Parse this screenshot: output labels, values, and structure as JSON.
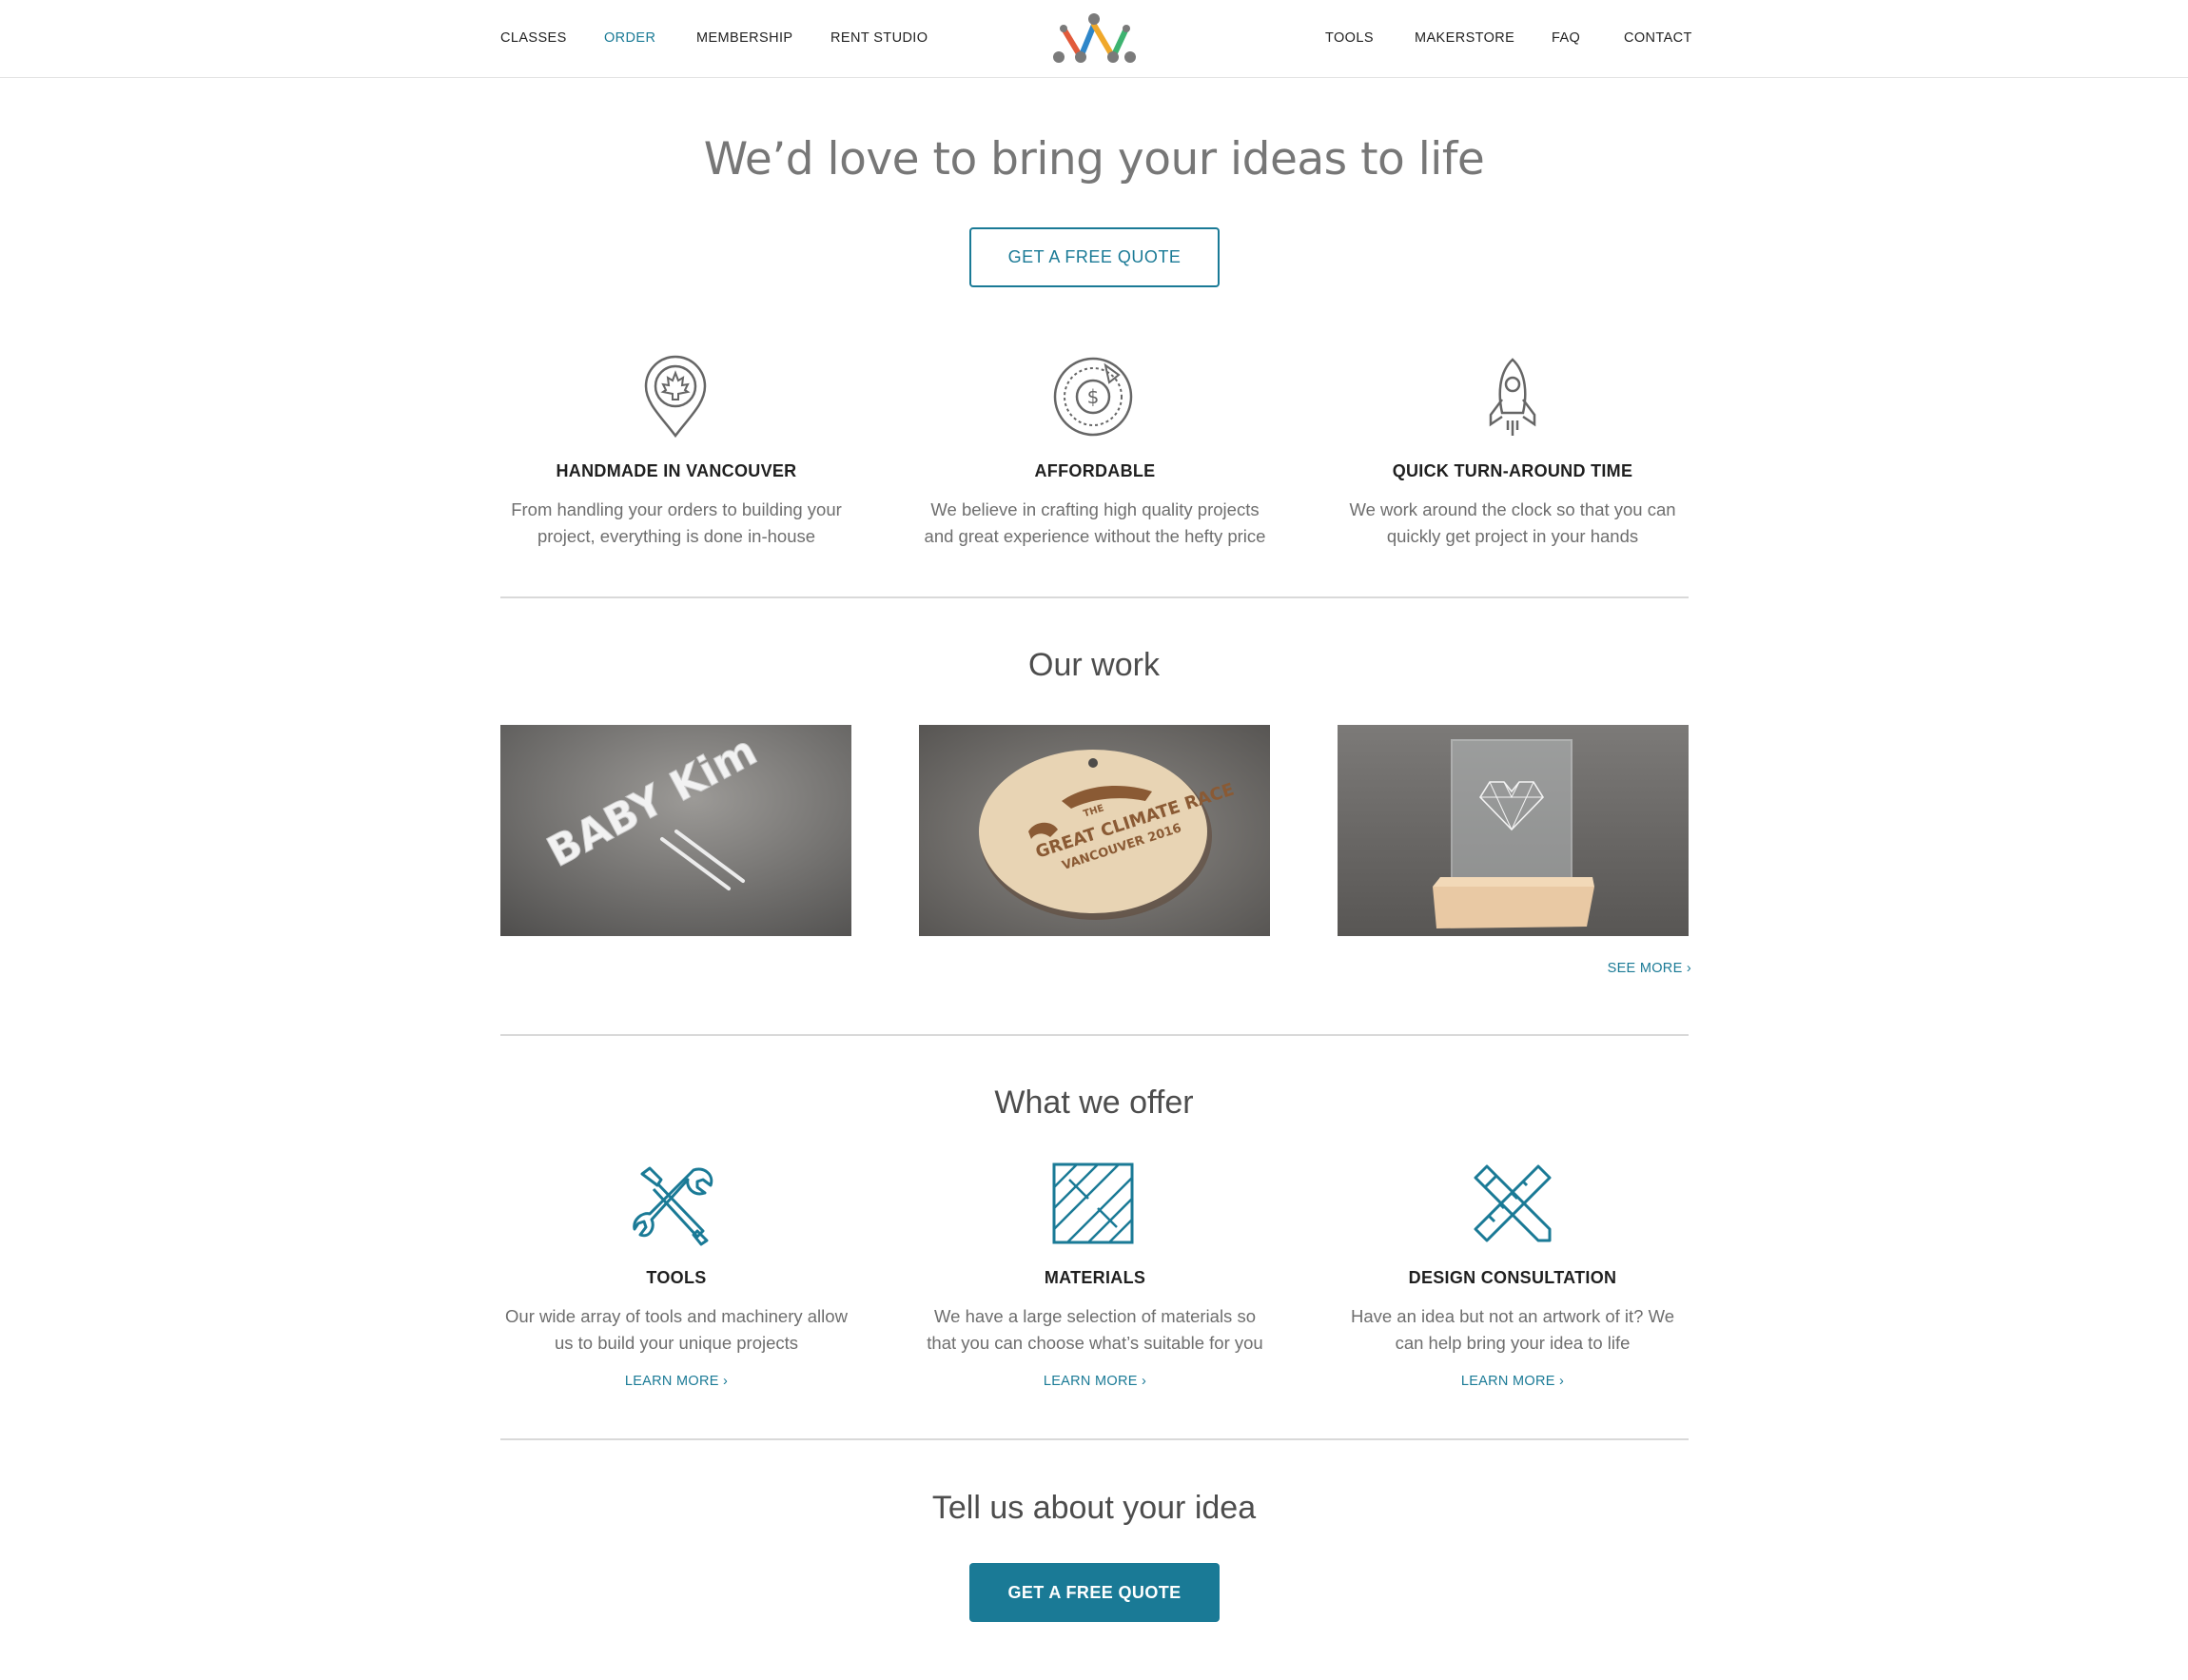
{
  "nav": {
    "left": [
      "CLASSES",
      "ORDER",
      "MEMBERSHIP",
      "RENT STUDIO"
    ],
    "right": [
      "TOOLS",
      "MAKERSTORE",
      "FAQ",
      "CONTACT"
    ],
    "active": "ORDER",
    "accent_color": "#1a7a96"
  },
  "hero": {
    "title": "We’d love to bring your ideas to life",
    "button_label": "GET A FREE QUOTE"
  },
  "features": [
    {
      "icon": "maple-leaf-pin-icon",
      "title": "HANDMADE IN VANCOUVER",
      "line1": "From handling your orders to building your",
      "line2": "project, everything is done in-house"
    },
    {
      "icon": "dollar-coin-icon",
      "title": "AFFORDABLE",
      "line1": "We believe in crafting high quality projects",
      "line2": "and great experience without the hefty price"
    },
    {
      "icon": "rocket-icon",
      "title": "QUICK TURN-AROUND TIME",
      "line1": "We work around the clock so that you can",
      "line2": "quickly get project in your hands"
    }
  ],
  "our_work": {
    "title": "Our work",
    "images": [
      {
        "subject": "white acrylic cake topper on concrete",
        "text": "BABY Kim"
      },
      {
        "subject": "round wooden engraved tag",
        "line1": "THE",
        "line2": "GREAT CLIMATE RACE",
        "line3": "VANCOUVER 2016"
      },
      {
        "subject": "engraved acrylic plaque on wood base"
      }
    ],
    "see_more": "SEE MORE ›"
  },
  "offer": {
    "title": "What we offer",
    "items": [
      {
        "icon": "tools-icon",
        "title": "TOOLS",
        "line1": "Our wide array of tools and machinery allow",
        "line2": "us to build your unique projects",
        "link": "LEARN MORE ›"
      },
      {
        "icon": "materials-icon",
        "title": "MATERIALS",
        "line1": "We have a large selection of materials so",
        "line2": "that you can choose what’s suitable for you",
        "link": "LEARN MORE ›"
      },
      {
        "icon": "design-consultation-icon",
        "title": "DESIGN CONSULTATION",
        "line1": "Have an idea but not an artwork of it? We",
        "line2": "can help bring your idea to life",
        "link": "LEARN MORE ›"
      }
    ]
  },
  "cta": {
    "title": "Tell us about your idea",
    "button_label": "GET A FREE QUOTE"
  }
}
